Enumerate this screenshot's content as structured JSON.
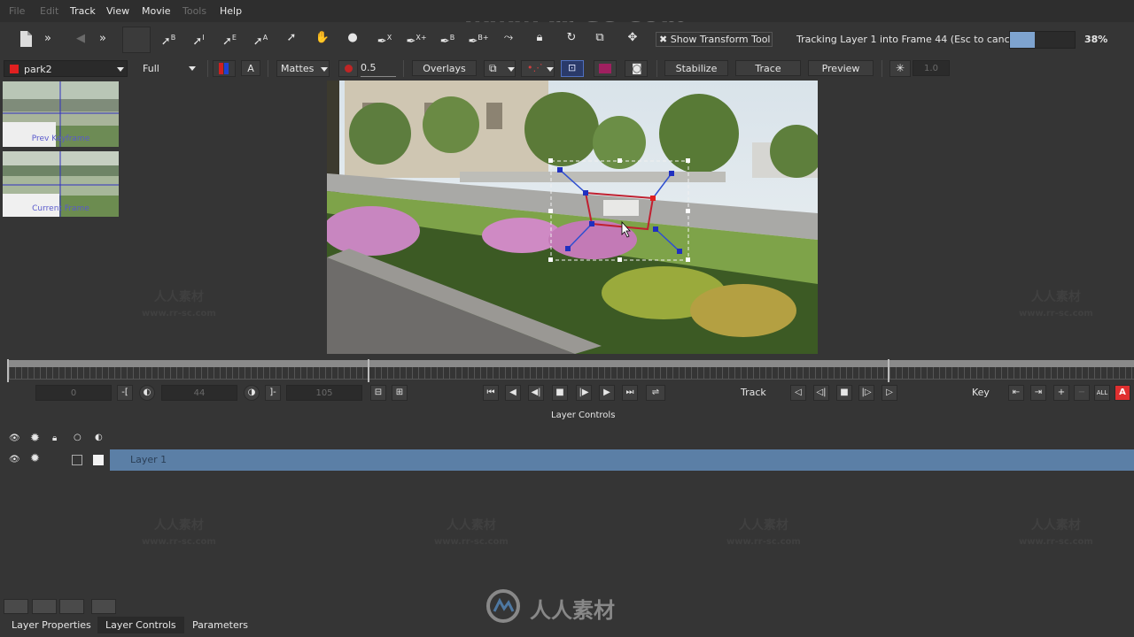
{
  "menu": {
    "items": [
      "File",
      "Edit",
      "Track",
      "View",
      "Movie",
      "Tools",
      "Help"
    ]
  },
  "toolbar": {
    "show_transform_label": "Show Transform Tool",
    "tracking_status": "Tracking Layer 1 into Frame 44 (Esc to cancel)",
    "progress_label": "38%",
    "progress_value": 0.38,
    "tool_labels": {
      "select_b": "B",
      "select_i": "I",
      "select_e": "E",
      "select_a": "A",
      "pen_x": "X",
      "pen_xplus": "X+",
      "pen_b": "B",
      "pen_bplus": "B+"
    }
  },
  "options": {
    "clip_name": "park2",
    "view_mode": "Full",
    "text_a": "A",
    "mattes_label": "Mattes",
    "opacity_value": "0.5",
    "overlays_label": "Overlays",
    "stabilize_label": "Stabilize",
    "trace_label": "Trace",
    "preview_label": "Preview",
    "sparkle_value": "1.0",
    "clip_color": "#e02020"
  },
  "thumbs": {
    "prev_label": "Prev Keyframe",
    "current_label": "Current Frame"
  },
  "transport": {
    "start_frame": "0",
    "current_frame": "44",
    "end_frame": "105",
    "track_label": "Track",
    "key_label": "Key",
    "all_label": "ALL",
    "a_label": "A",
    "layer_controls_title": "Layer Controls"
  },
  "layers": {
    "items": [
      {
        "name": "Layer 1",
        "selected": true
      }
    ],
    "selected_color": "#5b7fa6"
  },
  "bottom_tabs": [
    "Layer Properties",
    "Layer Controls",
    "Parameters"
  ],
  "watermark": {
    "url": "www.rr-sc.com",
    "cn": "人人素材",
    "brand": "人人素材"
  }
}
